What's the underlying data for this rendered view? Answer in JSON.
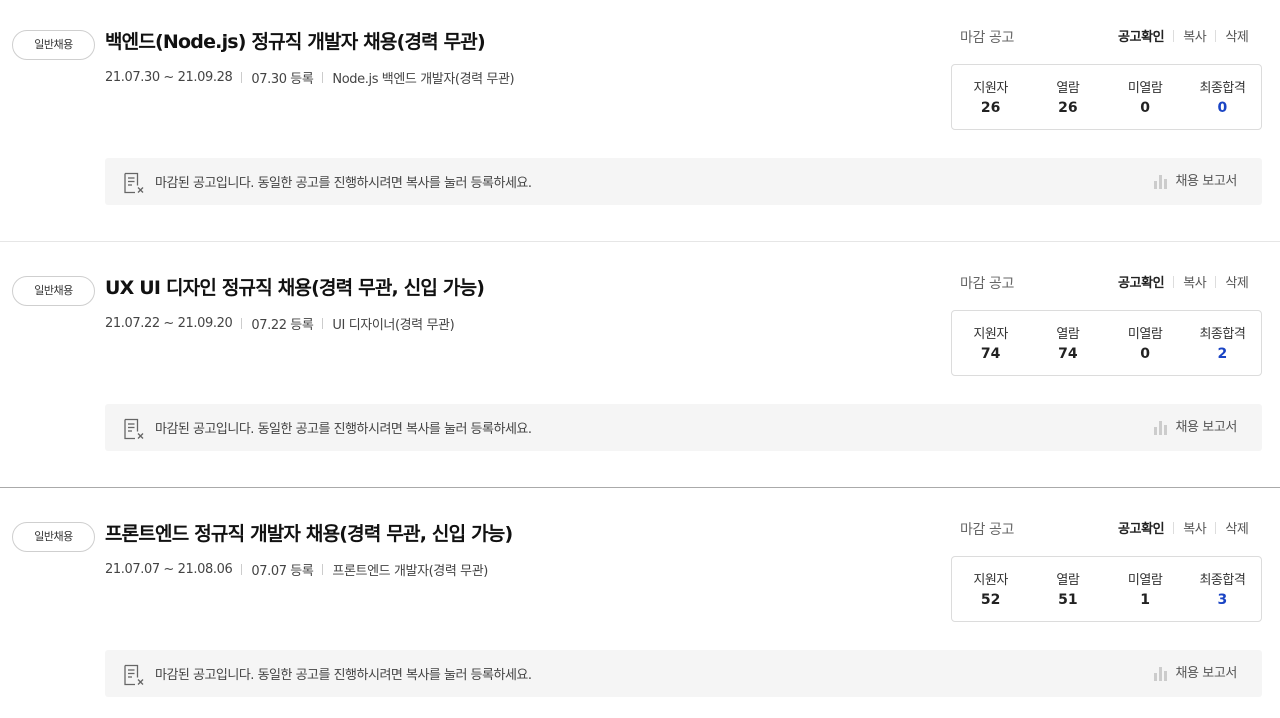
{
  "jobs": [
    {
      "badge": "일반채용",
      "title": "백엔드(Node.js) 정규직 개발자 채용(경력 무관)",
      "period": "21.07.30 ~ 21.09.28",
      "registered": "07.30 등록",
      "position": "Node.js 백엔드 개발자(경력 무관)",
      "status": "마감 공고",
      "actions": {
        "confirm": "공고확인",
        "copy": "복사",
        "delete": "삭제"
      },
      "stats": {
        "applicants_label": "지원자",
        "applicants": "26",
        "viewed_label": "열람",
        "viewed": "26",
        "unviewed_label": "미열람",
        "unviewed": "0",
        "final_label": "최종합격",
        "final": "0"
      },
      "notice": "마감된 공고입니다. 동일한 공고를 진행하시려면 복사를 눌러 등록하세요.",
      "report": "채용 보고서"
    },
    {
      "badge": "일반채용",
      "title": "UX UI 디자인 정규직 채용(경력 무관, 신입 가능)",
      "period": "21.07.22 ~ 21.09.20",
      "registered": "07.22 등록",
      "position": "UI 디자이너(경력 무관)",
      "status": "마감 공고",
      "actions": {
        "confirm": "공고확인",
        "copy": "복사",
        "delete": "삭제"
      },
      "stats": {
        "applicants_label": "지원자",
        "applicants": "74",
        "viewed_label": "열람",
        "viewed": "74",
        "unviewed_label": "미열람",
        "unviewed": "0",
        "final_label": "최종합격",
        "final": "2"
      },
      "notice": "마감된 공고입니다. 동일한 공고를 진행하시려면 복사를 눌러 등록하세요.",
      "report": "채용 보고서"
    },
    {
      "badge": "일반채용",
      "title": "프론트엔드 정규직 개발자 채용(경력 무관, 신입 가능)",
      "period": "21.07.07 ~ 21.08.06",
      "registered": "07.07 등록",
      "position": "프론트엔드 개발자(경력 무관)",
      "status": "마감 공고",
      "actions": {
        "confirm": "공고확인",
        "copy": "복사",
        "delete": "삭제"
      },
      "stats": {
        "applicants_label": "지원자",
        "applicants": "52",
        "viewed_label": "열람",
        "viewed": "51",
        "unviewed_label": "미열람",
        "unviewed": "1",
        "final_label": "최종합격",
        "final": "3"
      },
      "notice": "마감된 공고입니다. 동일한 공고를 진행하시려면 복사를 눌러 등록하세요.",
      "report": "채용 보고서"
    }
  ],
  "icons": {
    "notice": "closed-document-icon",
    "report": "bar-chart-icon"
  },
  "colors": {
    "final_count": "#1a44c4",
    "notice_bg": "#f5f5f5"
  }
}
